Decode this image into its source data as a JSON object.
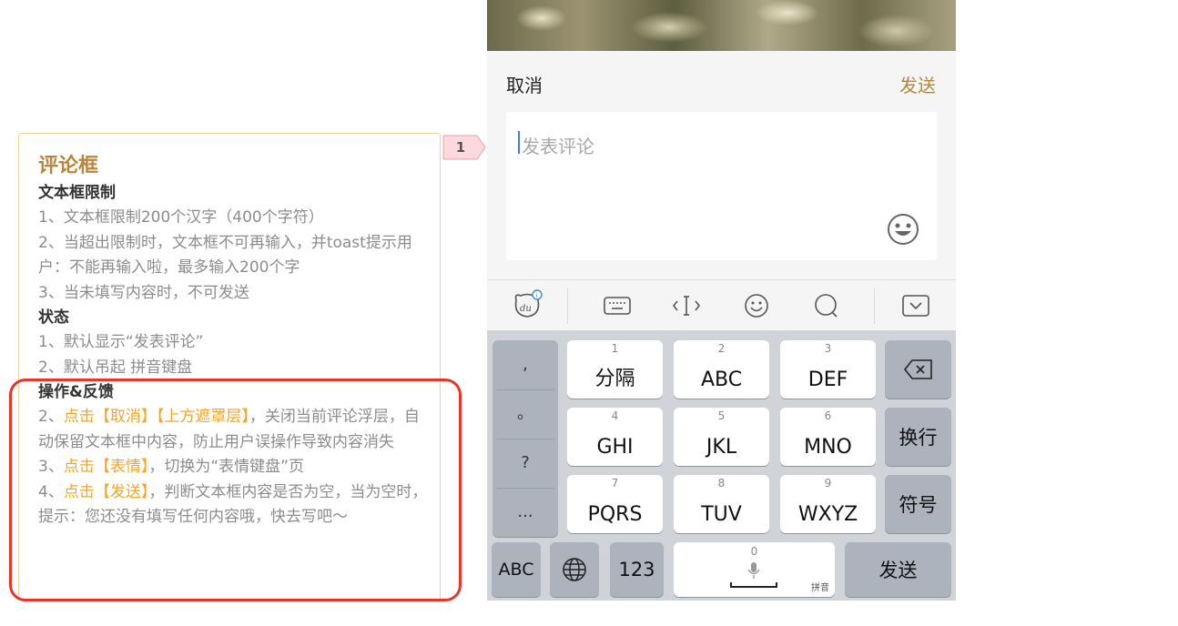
{
  "annotation": {
    "marker": "1",
    "title": "评论框",
    "sections": [
      {
        "heading": "文本框限制",
        "lines": [
          "1、文本框限制200个汉字（400个字符）",
          "2、当超出限制时，文本框不可再输入，并toast提示用户：不能再输入啦，最多输入200个字",
          "3、当未填写内容时，不可发送"
        ]
      },
      {
        "heading": "状态",
        "lines": [
          "1、默认显示“发表评论”",
          "2、默认吊起 拼音键盘"
        ]
      },
      {
        "heading": "操作&反馈",
        "items": [
          {
            "prefix": "2、",
            "action": "点击【取消】【上方遮罩层】",
            "rest": "，关闭当前评论浮层，自动保留文本框中内容，防止用户误操作导致内容消失"
          },
          {
            "prefix": "3、",
            "action": "点击【表情】",
            "rest": "，切换为“表情键盘”页"
          },
          {
            "prefix": "4、",
            "action": "点击【发送】",
            "rest": "，判断文本框内容是否为空，当为空时，提示：您还没有填写任何内容哦，快去写吧～"
          }
        ]
      }
    ]
  },
  "comment_bar": {
    "cancel_label": "取消",
    "send_label": "发送",
    "placeholder": "发表评论"
  },
  "keyboard": {
    "punctuation": [
      ",",
      "。",
      "?",
      "..."
    ],
    "keys": [
      {
        "num": "1",
        "label": "分隔"
      },
      {
        "num": "2",
        "label": "ABC"
      },
      {
        "num": "3",
        "label": "DEF"
      },
      {
        "num": "4",
        "label": "GHI"
      },
      {
        "num": "5",
        "label": "JKL"
      },
      {
        "num": "6",
        "label": "MNO"
      },
      {
        "num": "7",
        "label": "PQRS"
      },
      {
        "num": "8",
        "label": "TUV"
      },
      {
        "num": "9",
        "label": "WXYZ"
      }
    ],
    "enter_label": "换行",
    "symbol_label": "符号",
    "abc_label": "ABC",
    "num_label": "123",
    "space_num": "0",
    "space_sub": "拼音",
    "send_label": "发送"
  },
  "colors": {
    "accent": "#b8863b",
    "highlight": "#f5a623",
    "red_frame": "#e5362b"
  }
}
